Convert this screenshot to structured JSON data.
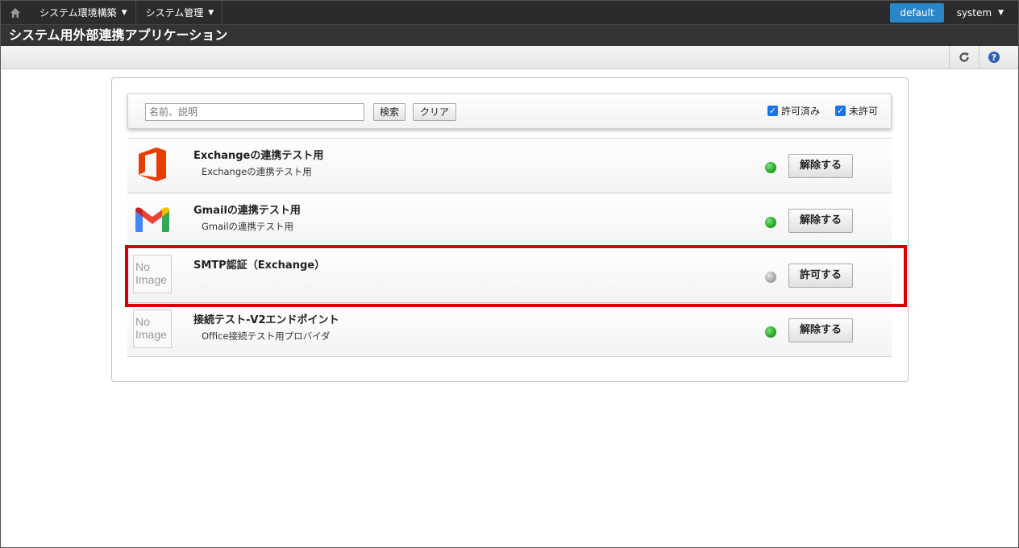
{
  "topnav": {
    "home_icon": "home-icon",
    "menus": [
      {
        "label": "システム環境構築"
      },
      {
        "label": "システム管理"
      }
    ],
    "caret": "▼",
    "tenant": "default",
    "user": "system"
  },
  "title": "システム用外部連携アプリケーション",
  "toolbar": {
    "refresh_icon": "refresh-icon",
    "help_icon": "help-icon"
  },
  "search": {
    "placeholder": "名前、説明",
    "value": "",
    "search_label": "検索",
    "clear_label": "クリア",
    "filters": [
      {
        "label": "許可済み",
        "checked": true
      },
      {
        "label": "未許可",
        "checked": true
      }
    ]
  },
  "apps": [
    {
      "name": "Exchangeの連携テスト用",
      "description": "Exchangeの連携テスト用",
      "icon": "office-icon",
      "status": "permitted",
      "action": "解除する"
    },
    {
      "name": "Gmailの連携テスト用",
      "description": "Gmailの連携テスト用",
      "icon": "gmail-icon",
      "status": "permitted",
      "action": "解除する"
    },
    {
      "name": "SMTP認証（Exchange）",
      "description": "",
      "icon": "no-image",
      "icon_text": [
        "No",
        "Image"
      ],
      "status": "not-permitted",
      "action": "許可する"
    },
    {
      "name": "接続テスト-V2エンドポイント",
      "description": "Office接続テスト用プロバイダ",
      "icon": "no-image",
      "icon_text": [
        "No",
        "Image"
      ],
      "status": "permitted",
      "action": "解除する"
    }
  ],
  "colors": {
    "nav_bg": "#2b2b2b",
    "tenant_bg": "#2a86c8",
    "status_on": "#1da11d",
    "status_off": "#a0a0a0",
    "highlight": "#d40000"
  }
}
